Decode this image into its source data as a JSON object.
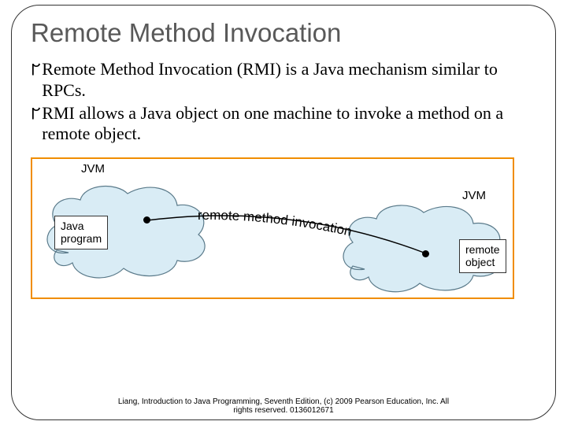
{
  "title": "Remote Method Invocation",
  "bullets": [
    "Remote Method Invocation (RMI) is a Java mechanism similar to RPCs.",
    "RMI allows a Java object on one machine to invoke a method on a remote object."
  ],
  "diagram": {
    "jvm_left": "JVM",
    "jvm_right": "JVM",
    "box_left_line1": "Java",
    "box_left_line2": "program",
    "box_right_line1": "remote",
    "box_right_line2": "object",
    "arc_text": "remote method invocation"
  },
  "footer_line1": "Liang, Introduction to Java Programming, Seventh Edition, (c) 2009 Pearson Education, Inc. All",
  "footer_line2": "rights reserved. 0136012671"
}
